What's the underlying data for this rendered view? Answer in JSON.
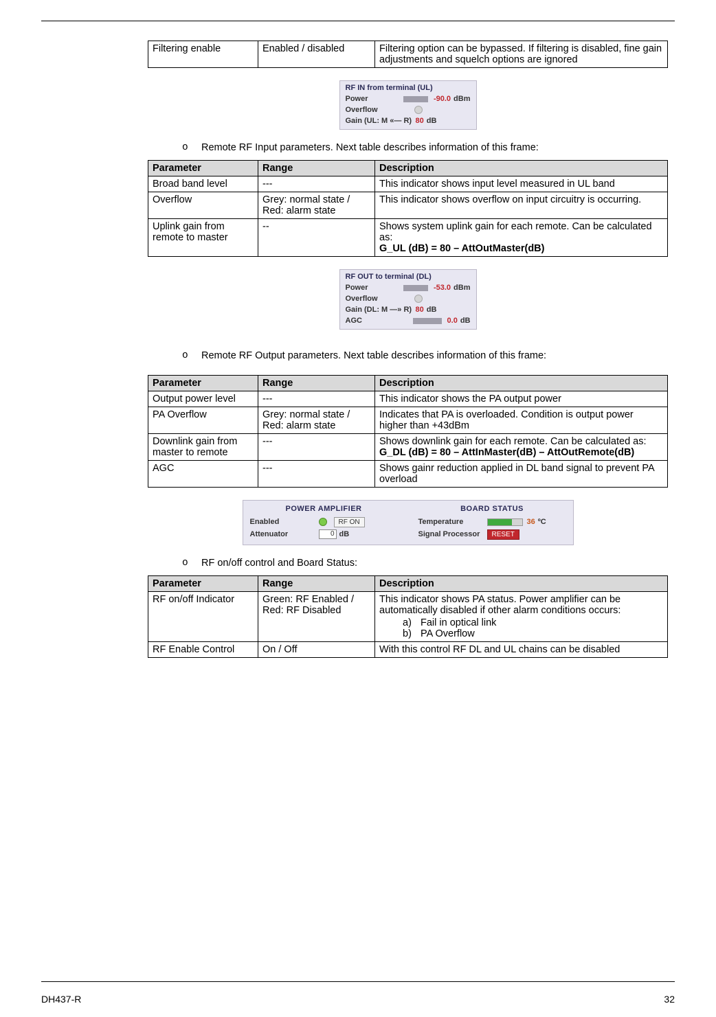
{
  "top_table": {
    "r0": {
      "param": "Filtering enable",
      "range": "Enabled / disabled",
      "desc": "Filtering option can be bypassed. If filtering is disabled, fine gain adjustments and squelch options are ignored"
    }
  },
  "panel_in": {
    "title": "RF IN from terminal (UL)",
    "power_lbl": "Power",
    "power_val": "-90.0",
    "power_unit": "dBm",
    "ovf_lbl": "Overflow",
    "gain_lbl": "Gain (UL: M «— R)",
    "gain_val": "80",
    "gain_unit": "dB"
  },
  "bullet1": "Remote RF Input parameters. Next table describes information of this frame:",
  "table1": {
    "h1": "Parameter",
    "h2": "Range",
    "h3": "Description",
    "r0": {
      "p": "Broad band level",
      "r": "---",
      "d": "This indicator shows input level measured in UL band"
    },
    "r1": {
      "p": "Overflow",
      "r": "Grey: normal state / Red: alarm state",
      "d": "This indicator shows overflow on input circuitry is occurring."
    },
    "r2": {
      "p": "Uplink gain from remote to master",
      "r": "--",
      "d_l1": "Shows system uplink gain for each remote. Can be calculated as:",
      "d_l2": "G_UL (dB) = 80 – AttOutMaster(dB)"
    }
  },
  "panel_out": {
    "title": "RF OUT to terminal (DL)",
    "power_lbl": "Power",
    "power_val": "-53.0",
    "power_unit": "dBm",
    "ovf_lbl": "Overflow",
    "gain_lbl": "Gain (DL: M —» R)",
    "gain_val": "80",
    "gain_unit": "dB",
    "agc_lbl": "AGC",
    "agc_val": "0.0",
    "agc_unit": "dB"
  },
  "bullet2": "Remote RF Output parameters. Next table describes information of this frame:",
  "table2": {
    "h1": "Parameter",
    "h2": "Range",
    "h3": "Description",
    "r0": {
      "p": "Output power level",
      "r": "---",
      "d": "This indicator shows the PA output power"
    },
    "r1": {
      "p": " PA Overflow",
      "r": "Grey: normal state / Red: alarm state",
      "d": "Indicates that PA is overloaded. Condition is output power higher than +43dBm"
    },
    "r2": {
      "p": "Downlink gain from master to remote",
      "r": "---",
      "d_l1": "Shows downlink gain for each remote. Can be calculated as:",
      "d_l2": "G_DL (dB) = 80 – AttInMaster(dB) – AttOutRemote(dB)"
    },
    "r3": {
      "p": "AGC",
      "r": "---",
      "d": "Shows gainr reduction applied in DL band signal to prevent PA overload"
    }
  },
  "wide_panel": {
    "pa_hdr": "POWER AMPLIFIER",
    "en_lbl": "Enabled",
    "rf_btn": "RF ON",
    "att_lbl": "Attenuator",
    "att_val": "0",
    "att_unit": "dB",
    "bs_hdr": "BOARD STATUS",
    "temp_lbl": "Temperature",
    "temp_val": "36",
    "temp_unit": "ºC",
    "sp_lbl": "Signal Processor",
    "reset_btn": "RESET"
  },
  "bullet3": "RF on/off control and Board Status:",
  "table3": {
    "h1": "Parameter",
    "h2": "Range",
    "h3": "Description",
    "r0": {
      "p": "RF on/off Indicator",
      "r": "Green: RF Enabled / Red: RF Disabled",
      "d_main": "This indicator shows PA status. Power amplifier can be automatically disabled if other alarm conditions occurs:",
      "d_a_k": "a)",
      "d_a_v": "Fail in optical link",
      "d_b_k": "b)",
      "d_b_v": "PA Overflow"
    },
    "r1": {
      "p": "RF Enable Control",
      "r": "On / Off",
      "d": "With this control RF DL and UL chains can be disabled"
    }
  },
  "footer": {
    "left": "DH437-R",
    "right": "32"
  }
}
